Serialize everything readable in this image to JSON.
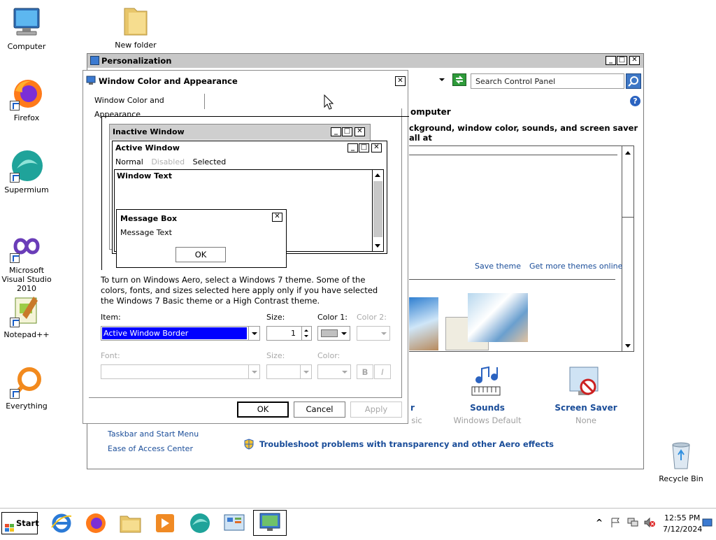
{
  "desktop": {
    "icons": [
      {
        "label": "Computer"
      },
      {
        "label": "New folder"
      },
      {
        "label": "Firefox"
      },
      {
        "label": "Supermium"
      },
      {
        "label": "Microsoft Visual Studio 2010"
      },
      {
        "label": "Notepad++"
      },
      {
        "label": "Everything"
      },
      {
        "label": "Recycle Bin"
      }
    ]
  },
  "personalization": {
    "title": "Personalization",
    "search_placeholder": "Search Control Panel",
    "heading_fragment": "omputer",
    "desc_fragment": "ckground, window color, sounds, and screen saver all at",
    "save_theme": "Save theme",
    "get_more_themes": "Get more themes online",
    "categories": [
      {
        "title": "r",
        "subtitle": "sic"
      },
      {
        "title": "Sounds",
        "subtitle": "Windows Default"
      },
      {
        "title": "Screen Saver",
        "subtitle": "None"
      }
    ],
    "see_also": [
      "Taskbar and Start Menu",
      "Ease of Access Center"
    ],
    "troubleshoot": "Troubleshoot problems with transparency and other Aero effects"
  },
  "dialog": {
    "title": "Window Color and Appearance",
    "tab": "Window Color and Appearance",
    "preview": {
      "inactive_window": "Inactive Window",
      "active_window": "Active Window",
      "menu_normal": "Normal",
      "menu_disabled": "Disabled",
      "menu_selected": "Selected",
      "window_text": "Window Text",
      "message_box": "Message Box",
      "message_text": "Message Text",
      "ok": "OK"
    },
    "description": "To turn on Windows Aero, select a Windows 7 theme.  Some of the colors, fonts, and sizes selected here apply only if you have selected the Windows 7 Basic theme or a High Contrast theme.",
    "item_label": "Item:",
    "item_value": "Active Window Border",
    "size_label": "Size:",
    "size_value": "1",
    "color1_label": "Color 1:",
    "color1_value": "#c0c0c0",
    "color2_label": "Color 2:",
    "font_label": "Font:",
    "font_size_label": "Size:",
    "font_color_label": "Color:",
    "bold": "B",
    "italic": "I",
    "ok": "OK",
    "cancel": "Cancel",
    "apply": "Apply"
  },
  "taskbar": {
    "start": "Start",
    "time": "12:55 PM",
    "date": "7/12/2024"
  },
  "colors": {
    "title_gray": "#c8c8c8",
    "link_blue": "#1a4d99",
    "selection_blue": "#0000ff"
  }
}
